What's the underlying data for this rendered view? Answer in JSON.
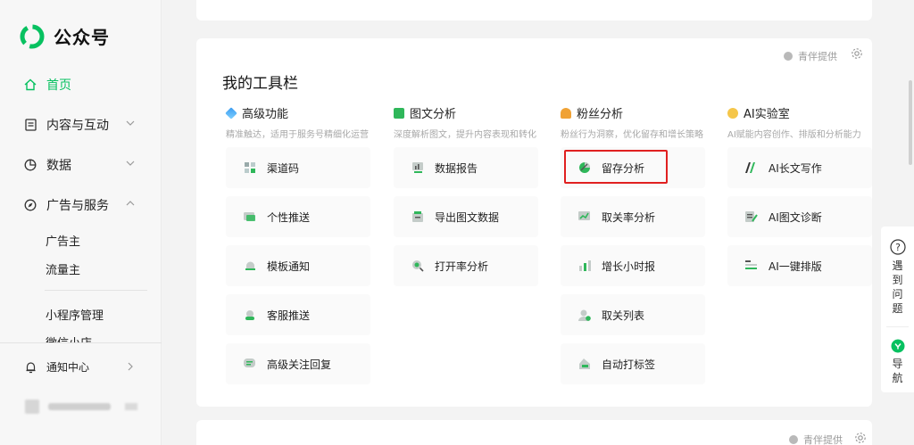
{
  "app": {
    "name": "公众号",
    "brand_color": "#07c160"
  },
  "sidebar": {
    "items": [
      {
        "label": "首页",
        "icon": "home-icon",
        "active": true
      },
      {
        "label": "内容与互动",
        "icon": "document-icon",
        "chevron": "down"
      },
      {
        "label": "数据",
        "icon": "pie-chart-icon",
        "chevron": "down"
      },
      {
        "label": "广告与服务",
        "icon": "compass-icon",
        "chevron": "up"
      }
    ],
    "sub_items": [
      {
        "label": "广告主"
      },
      {
        "label": "流量主"
      },
      {
        "label": "小程序管理"
      },
      {
        "label": "微信小店"
      }
    ],
    "notice": {
      "label": "通知中心",
      "icon": "bell-icon"
    }
  },
  "toolbar_card": {
    "title": "我的工具栏",
    "provided_by": "青伴提供",
    "columns": [
      {
        "title": "高级功能",
        "icon": "layers-icon",
        "desc": "精准触达，适用于服务号精细化运营",
        "tools": [
          "渠道码",
          "个性推送",
          "模板通知",
          "客服推送",
          "高级关注回复"
        ]
      },
      {
        "title": "图文分析",
        "icon": "bar-chart-icon",
        "desc": "深度解析图文，提升内容表现和转化",
        "tools": [
          "数据报告",
          "导出图文数据",
          "打开率分析"
        ]
      },
      {
        "title": "粉丝分析",
        "icon": "user-icon",
        "desc": "粉丝行为洞察，优化留存和增长策略",
        "tools": [
          "留存分析",
          "取关率分析",
          "增长小时报",
          "取关列表",
          "自动打标签"
        ]
      },
      {
        "title": "AI实验室",
        "icon": "ai-face-icon",
        "desc": "AI赋能内容创作、排版和分析能力",
        "tools": [
          "AI长文写作",
          "AI图文诊断",
          "AI一键排版"
        ]
      }
    ]
  },
  "bottom_card": {
    "provided_by": "青伴提供"
  },
  "float_panel": {
    "help_label": "遇到问题",
    "nav_label": "导航"
  }
}
